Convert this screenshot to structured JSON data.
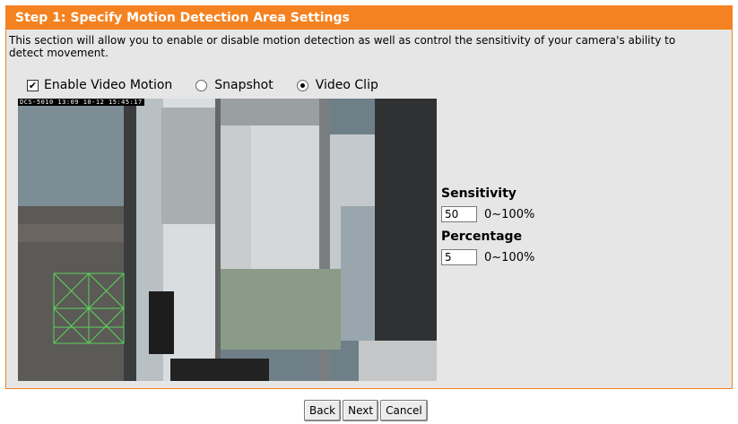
{
  "header": {
    "title": "Step 1: Specify Motion Detection Area Settings"
  },
  "description": "This section will allow you to enable or disable motion detection as well as control the sensitivity of your camera's ability to detect movement.",
  "options": {
    "enable_label": "Enable Video Motion",
    "enable_checked": true,
    "snapshot_label": "Snapshot",
    "videoclip_label": "Video Clip",
    "selected": "Video Clip"
  },
  "video": {
    "timestamp": "DCS-5010 13:09 10-12 15:45:17"
  },
  "sensitivity": {
    "label": "Sensitivity",
    "value": "50",
    "range": "0~100%"
  },
  "percentage": {
    "label": "Percentage",
    "value": "5",
    "range": "0~100%"
  },
  "buttons": {
    "back": "Back",
    "next": "Next",
    "cancel": "Cancel"
  },
  "colors": {
    "accent": "#f58220",
    "panel": "#e6e6e6",
    "grid": "#5dd35d"
  }
}
